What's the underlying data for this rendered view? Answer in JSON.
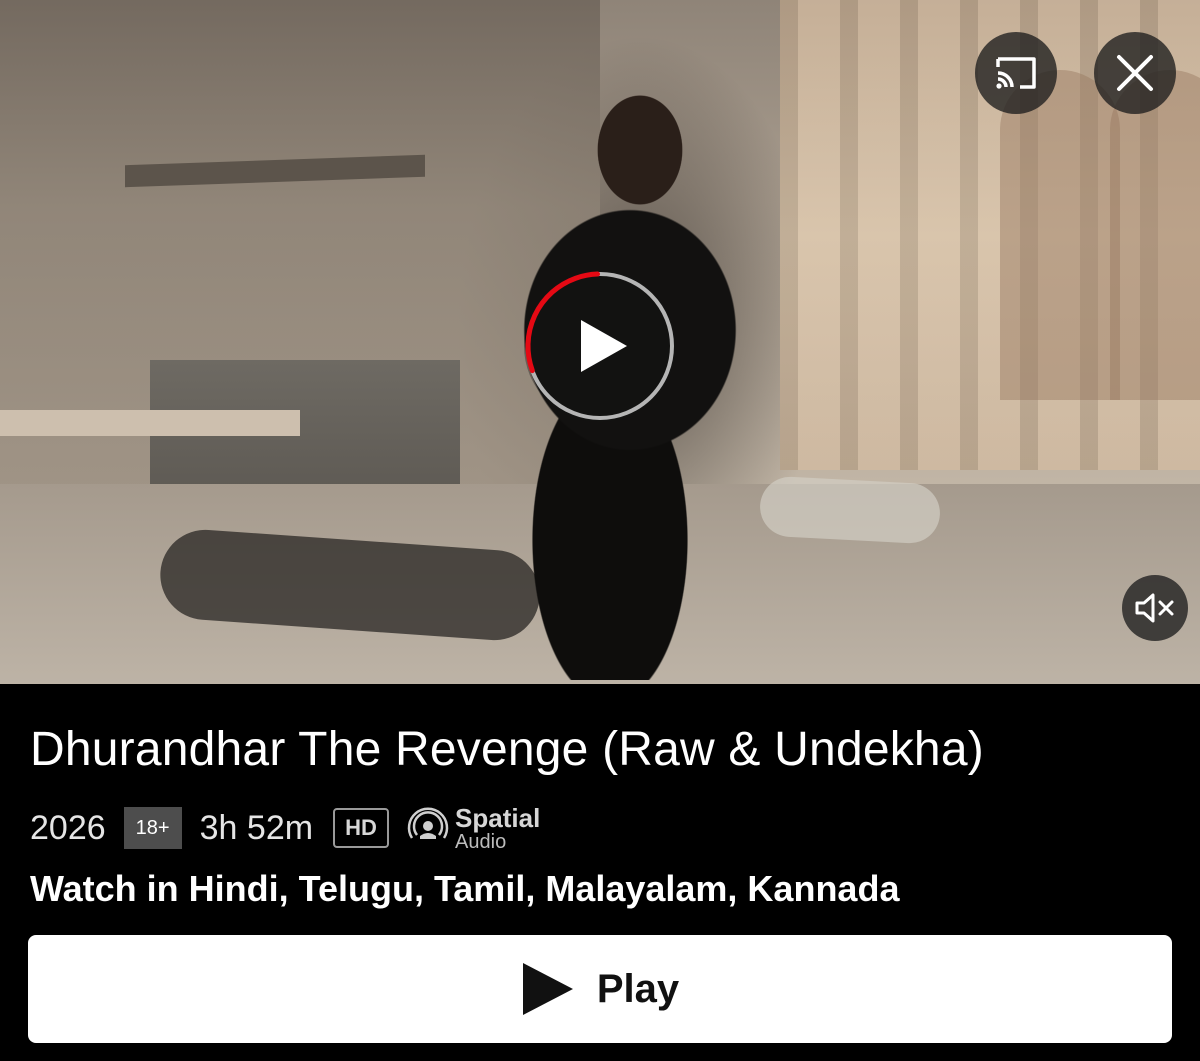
{
  "player": {
    "cast_icon": "cast-icon",
    "close_icon": "close-icon",
    "mute_icon": "mute-icon",
    "center_play_icon": "play-icon",
    "progress_accent": "#e50914",
    "progress_fraction": 0.3
  },
  "title": {
    "text": "Dhurandhar The Revenge (Raw & Undekha)"
  },
  "meta": {
    "year": "2026",
    "rating": "18+",
    "duration": "3h 52m",
    "quality": "HD",
    "spatial_top": "Spatial",
    "spatial_bottom": "Audio",
    "spatial_icon": "spatial-audio-icon"
  },
  "languages": {
    "text": "Watch in Hindi, Telugu, Tamil, Malayalam, Kannada"
  },
  "play_button": {
    "label": "Play",
    "icon": "play-icon"
  }
}
